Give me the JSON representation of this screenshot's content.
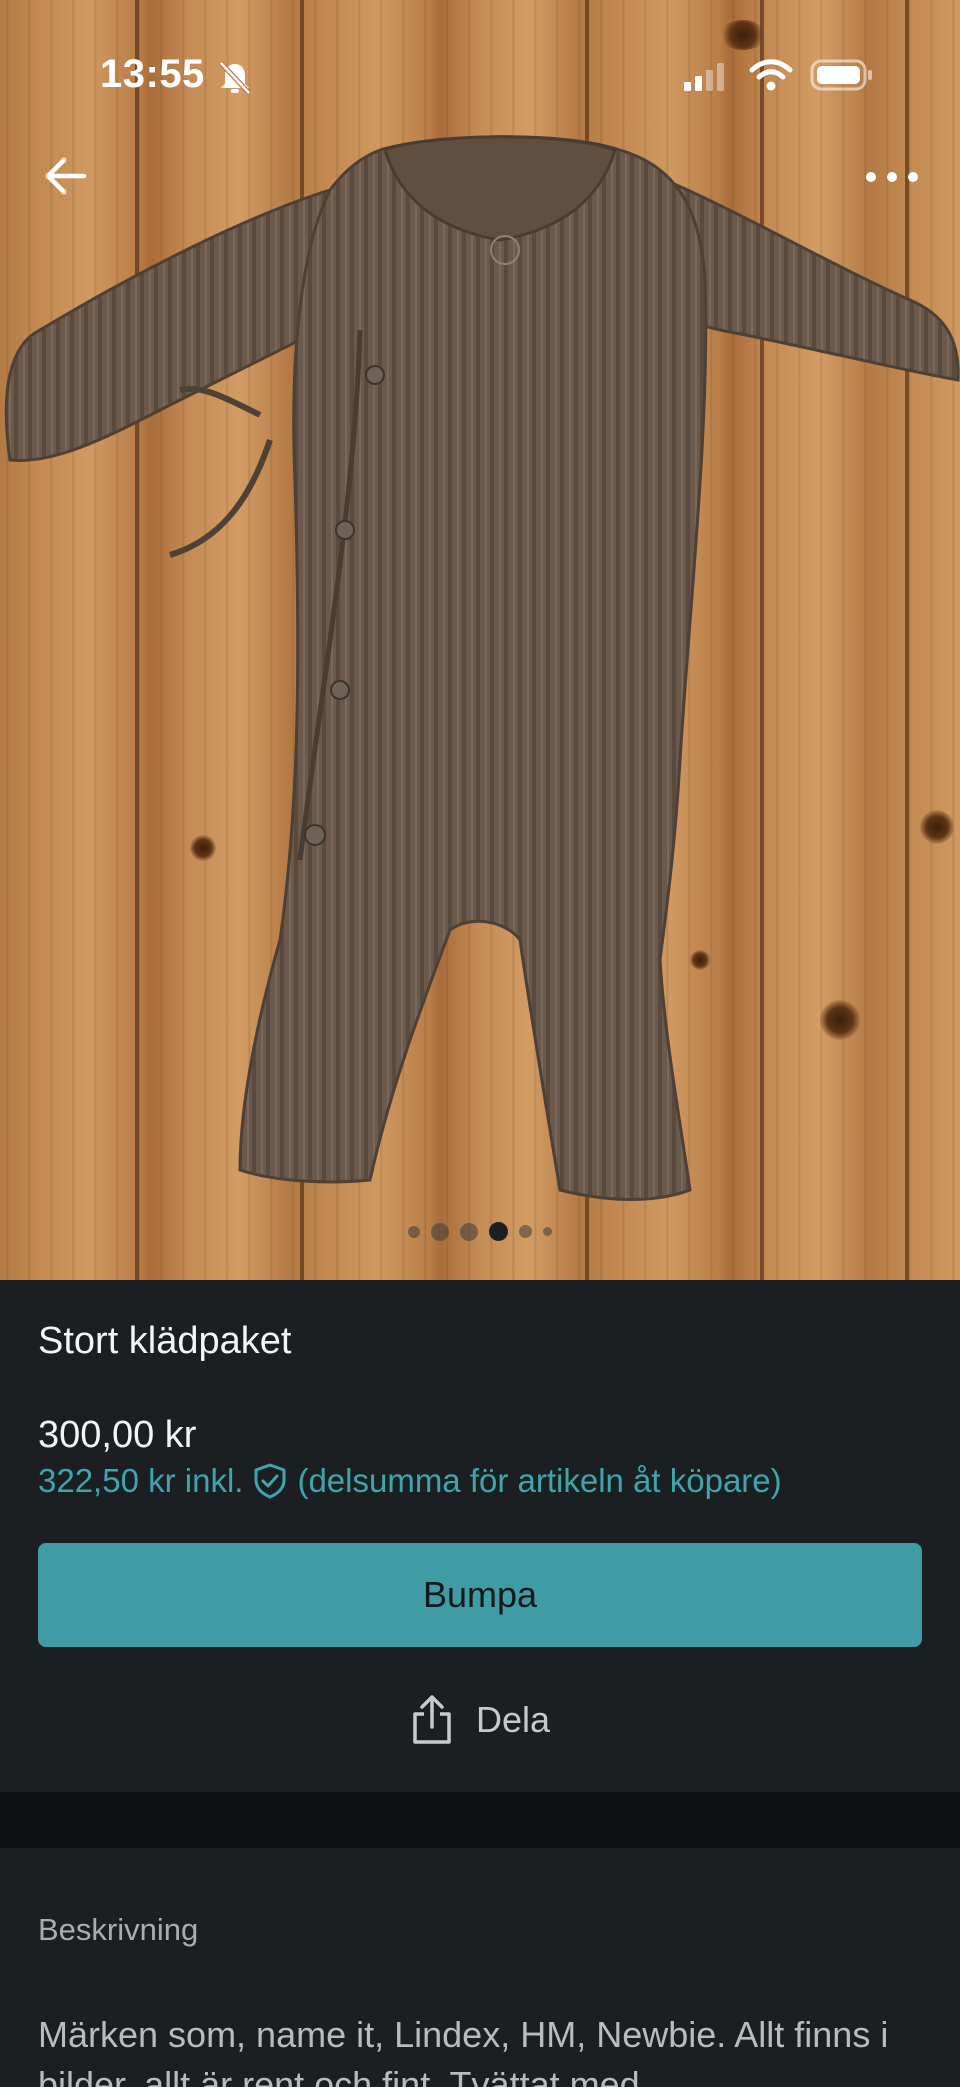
{
  "status_bar": {
    "time": "13:55",
    "icons": [
      "bell-slash-icon",
      "cellular-signal-icon",
      "wifi-icon",
      "battery-icon"
    ]
  },
  "photo": {
    "subject": "brown ribbed baby romper on wooden floor",
    "carousel_total": 6,
    "carousel_active_index": 3
  },
  "nav": {
    "back_icon": "arrow-left-icon",
    "menu_icon": "more-horizontal-icon"
  },
  "listing": {
    "title": "Stort klädpaket",
    "price": "300,00 kr",
    "price_incl": "322,50 kr inkl.",
    "price_incl_note": "(delsumma för artikeln åt köpare)",
    "protection_icon": "shield-check-icon",
    "bump_label": "Bumpa",
    "share_label": "Dela",
    "share_icon": "share-icon"
  },
  "description": {
    "label": "Beskrivning",
    "text": "Märken som, name it, Lindex, HM, Newbie. Allt finns i bilder, allt är rent och fint. Tvättat med"
  },
  "colors": {
    "accent": "#3f9ba4",
    "accent_text": "#3fa5ad",
    "background": "#1b1f22"
  }
}
